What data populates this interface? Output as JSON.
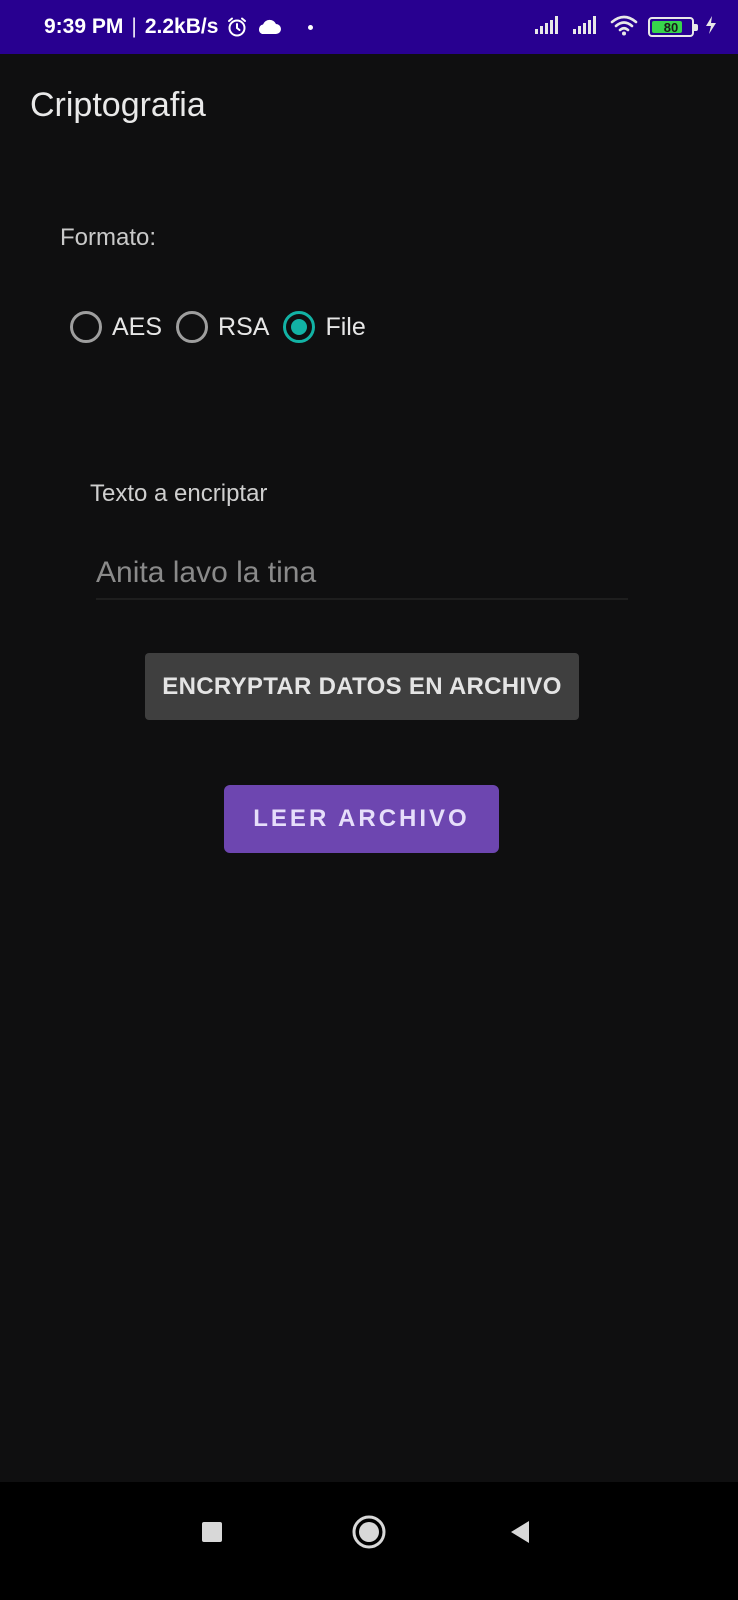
{
  "status_bar": {
    "time": "9:39 PM",
    "separator": "|",
    "network_speed": "2.2kB/s",
    "battery_level": "80",
    "battery_fraction": 0.8,
    "icons": [
      "alarm-icon",
      "cloud-icon",
      "notification-dot",
      "signal-icon",
      "signal-icon",
      "wifi-icon",
      "battery-icon",
      "charging-icon"
    ]
  },
  "app": {
    "title": "Criptografia"
  },
  "form": {
    "format_label": "Formato:",
    "options": [
      {
        "label": "AES",
        "checked": false
      },
      {
        "label": "RSA",
        "checked": false
      },
      {
        "label": "File",
        "checked": true
      }
    ],
    "text_label": "Texto a encriptar",
    "text_value": "Anita lavo la tina",
    "encrypt_button": "ENCRYPTAR DATOS EN ARCHIVO",
    "read_button": "LEER ARCHIVO"
  },
  "colors": {
    "status_bar": "#280090",
    "background": "#0f0f10",
    "radio_accent": "#12b3a5",
    "primary_button": "#6d46b0",
    "secondary_button": "#3f3f3f"
  },
  "nav": {
    "buttons": [
      "recents-square-icon",
      "home-circle-icon",
      "back-triangle-icon"
    ]
  }
}
